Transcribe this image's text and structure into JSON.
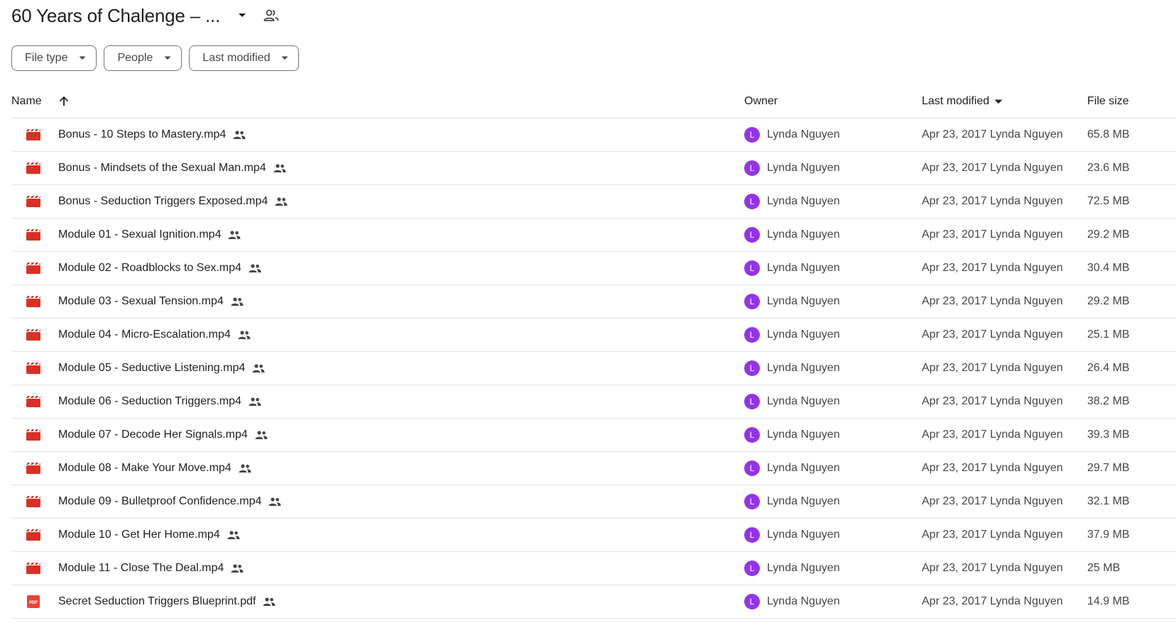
{
  "folder": {
    "title": "60 Years of Chalenge – ...",
    "menu_icon": "arrow-drop-down-icon",
    "share_icon": "people-outline-icon"
  },
  "filters": [
    {
      "label": "File type"
    },
    {
      "label": "People"
    },
    {
      "label": "Last modified"
    }
  ],
  "columns": {
    "name": "Name",
    "owner": "Owner",
    "last_modified": "Last modified",
    "file_size": "File size"
  },
  "files": [
    {
      "name": "Bonus - 10 Steps to Mastery.mp4",
      "type": "video",
      "owner": "Lynda Nguyen",
      "owner_initial": "L",
      "modified": "Apr 23, 2017 Lynda Nguyen",
      "size": "65.8 MB"
    },
    {
      "name": "Bonus - Mindsets of the Sexual Man.mp4",
      "type": "video",
      "owner": "Lynda Nguyen",
      "owner_initial": "L",
      "modified": "Apr 23, 2017 Lynda Nguyen",
      "size": "23.6 MB"
    },
    {
      "name": "Bonus - Seduction Triggers Exposed.mp4",
      "type": "video",
      "owner": "Lynda Nguyen",
      "owner_initial": "L",
      "modified": "Apr 23, 2017 Lynda Nguyen",
      "size": "72.5 MB"
    },
    {
      "name": "Module 01 - Sexual Ignition.mp4",
      "type": "video",
      "owner": "Lynda Nguyen",
      "owner_initial": "L",
      "modified": "Apr 23, 2017 Lynda Nguyen",
      "size": "29.2 MB"
    },
    {
      "name": "Module 02 - Roadblocks to Sex.mp4",
      "type": "video",
      "owner": "Lynda Nguyen",
      "owner_initial": "L",
      "modified": "Apr 23, 2017 Lynda Nguyen",
      "size": "30.4 MB"
    },
    {
      "name": "Module 03 - Sexual Tension.mp4",
      "type": "video",
      "owner": "Lynda Nguyen",
      "owner_initial": "L",
      "modified": "Apr 23, 2017 Lynda Nguyen",
      "size": "29.2 MB"
    },
    {
      "name": "Module 04 - Micro-Escalation.mp4",
      "type": "video",
      "owner": "Lynda Nguyen",
      "owner_initial": "L",
      "modified": "Apr 23, 2017 Lynda Nguyen",
      "size": "25.1 MB"
    },
    {
      "name": "Module 05 - Seductive Listening.mp4",
      "type": "video",
      "owner": "Lynda Nguyen",
      "owner_initial": "L",
      "modified": "Apr 23, 2017 Lynda Nguyen",
      "size": "26.4 MB"
    },
    {
      "name": "Module 06 - Seduction Triggers.mp4",
      "type": "video",
      "owner": "Lynda Nguyen",
      "owner_initial": "L",
      "modified": "Apr 23, 2017 Lynda Nguyen",
      "size": "38.2 MB"
    },
    {
      "name": "Module 07 - Decode Her Signals.mp4",
      "type": "video",
      "owner": "Lynda Nguyen",
      "owner_initial": "L",
      "modified": "Apr 23, 2017 Lynda Nguyen",
      "size": "39.3 MB"
    },
    {
      "name": "Module 08 - Make Your Move.mp4",
      "type": "video",
      "owner": "Lynda Nguyen",
      "owner_initial": "L",
      "modified": "Apr 23, 2017 Lynda Nguyen",
      "size": "29.7 MB"
    },
    {
      "name": "Module 09 - Bulletproof Confidence.mp4",
      "type": "video",
      "owner": "Lynda Nguyen",
      "owner_initial": "L",
      "modified": "Apr 23, 2017 Lynda Nguyen",
      "size": "32.1 MB"
    },
    {
      "name": "Module 10 - Get Her Home.mp4",
      "type": "video",
      "owner": "Lynda Nguyen",
      "owner_initial": "L",
      "modified": "Apr 23, 2017 Lynda Nguyen",
      "size": "37.9 MB"
    },
    {
      "name": "Module 11 - Close The Deal.mp4",
      "type": "video",
      "owner": "Lynda Nguyen",
      "owner_initial": "L",
      "modified": "Apr 23, 2017 Lynda Nguyen",
      "size": "25 MB"
    },
    {
      "name": "Secret Seduction Triggers Blueprint.pdf",
      "type": "pdf",
      "owner": "Lynda Nguyen",
      "owner_initial": "L",
      "modified": "Apr 23, 2017 Lynda Nguyen",
      "size": "14.9 MB"
    }
  ],
  "icons": {
    "video": "video-file-icon",
    "pdf": "pdf-file-icon",
    "pdf_badge": "PDF",
    "shared": "shared-people-icon",
    "sort_ascending": "arrow-upward-icon",
    "sort_modified": "arrow-drop-down-icon"
  },
  "colors": {
    "video_icon": "#d93025",
    "pdf_icon": "#ea4335",
    "avatar": "#9334e6",
    "border": "#e0e0e0",
    "chip_border": "#747775"
  }
}
